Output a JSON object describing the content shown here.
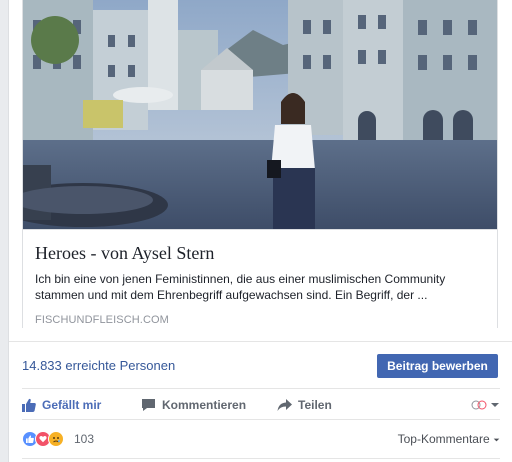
{
  "link_preview": {
    "title": "Heroes - von Aysel Stern",
    "description": "Ich bin eine von jenen Feministinnen, die aus einer muslimischen Community stammen und mit dem Ehrenbegriff aufgewachsen sind. Ein Begriff, der ...",
    "domain": "FISCHUNDFLEISCH.COM",
    "image": "town-square-photo"
  },
  "reach": {
    "text": "14.833 erreichte Personen",
    "boost_label": "Beitrag bewerben"
  },
  "actions": {
    "like_label": "Gefällt mir",
    "comment_label": "Kommentieren",
    "share_label": "Teilen"
  },
  "reactions": {
    "count": "103",
    "sort_label": "Top-Kommentare",
    "icons": [
      "like-reaction-icon",
      "love-reaction-icon",
      "sad-reaction-icon"
    ]
  },
  "colors": {
    "link": "#365899",
    "button": "#4267b2",
    "like_blue": "#4b6cb7",
    "love_red": "#f25268",
    "sad_yellow": "#f7b125"
  }
}
